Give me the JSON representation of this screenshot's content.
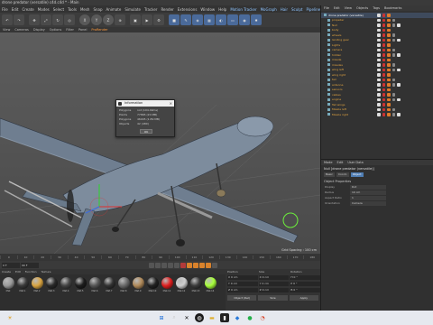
{
  "window": {
    "title": "drone predator (versatile) c4d.c4d * - Main"
  },
  "menubar": {
    "items": [
      "File",
      "Edit",
      "Create",
      "Modes",
      "Select",
      "Tools",
      "Mesh",
      "Snap",
      "Animate",
      "Simulate",
      "Tracker",
      "Render",
      "Extensions",
      "Window",
      "Help"
    ],
    "highlighted": [
      "Motion Tracker",
      "MoGraph",
      "Hair",
      "Sculpt",
      "Pipeline",
      "Plugins",
      "Script",
      "Window",
      "Help"
    ]
  },
  "toolbar": {
    "axis_x": "X",
    "axis_y": "Y",
    "axis_z": "Z"
  },
  "viewport_menu": {
    "items": [
      "View",
      "Cameras",
      "Display",
      "Options",
      "Filter",
      "Panel"
    ],
    "active": "ProRender"
  },
  "viewport": {
    "grid_spacing": "Grid Spacing : 100 cm"
  },
  "info_dialog": {
    "title": "Information",
    "rows": [
      {
        "label": "Polygons",
        "value": "not (104.49ms)"
      },
      {
        "label": "Points",
        "value": "77865 (20 MB)"
      },
      {
        "label": "Polygons",
        "value": "46045 (1.89 MB)"
      },
      {
        "label": "Objects",
        "value": "42 (480)"
      }
    ],
    "ok_label": "OK"
  },
  "timeline": {
    "ticks": [
      "0",
      "10",
      "20",
      "30",
      "40",
      "50",
      "60",
      "70",
      "80",
      "90",
      "100",
      "110",
      "120",
      "130",
      "140",
      "150",
      "160",
      "170",
      "180"
    ]
  },
  "transport": {
    "start_frame": "0 F",
    "end_frame": "90 F"
  },
  "materials": {
    "menu": [
      "Create",
      "Edit",
      "Function",
      "Texture"
    ],
    "items": [
      {
        "name": "Mat",
        "color": "#9a9a9a"
      },
      {
        "name": "Mat.1",
        "color": "#3a3a3a"
      },
      {
        "name": "Mat.2",
        "color": "#d9a441"
      },
      {
        "name": "Mat.3",
        "color": "#2a2a2a"
      },
      {
        "name": "Mat.4",
        "color": "#444444"
      },
      {
        "name": "Mat.5",
        "color": "#1e1e1e"
      },
      {
        "name": "Mat.6",
        "color": "#555555"
      },
      {
        "name": "Mat.7",
        "color": "#333333"
      },
      {
        "name": "Mat.8",
        "color": "#6a6a6a"
      },
      {
        "name": "Mat.9",
        "color": "#b08a5a"
      },
      {
        "name": "Mat.10",
        "color": "#222222"
      },
      {
        "name": "Mat.11",
        "color": "#e02020"
      },
      {
        "name": "Mat.12",
        "color": "#cfcfcf"
      },
      {
        "name": "Mat.13",
        "color": "#3c3c3c"
      },
      {
        "name": "Mat.14",
        "color": "#a8ff3a"
      }
    ]
  },
  "coordinates": {
    "headers": [
      "Position",
      "Size",
      "Rotation"
    ],
    "rows": [
      [
        "X 0 cm",
        "X 0 cm",
        "H 0 °"
      ],
      [
        "Y 0 cm",
        "Y 0 cm",
        "P 0 °"
      ],
      [
        "Z 0 cm",
        "Z 0 cm",
        "B 0 °"
      ]
    ],
    "object_mode": "Object (Rel)",
    "size_mode": "Size",
    "apply_label": "Apply"
  },
  "object_manager": {
    "menu": [
      "File",
      "Edit",
      "View",
      "Objects",
      "Tags",
      "Bookmarks"
    ],
    "objects": [
      "drone predator (versatile)",
      "propeller",
      "Null",
      "body",
      "wheels",
      "landing gear",
      "Lights",
      "camera",
      "hidden",
      "missile",
      "missiles",
      "wing left",
      "wing right",
      "tail",
      "antenna",
      "sensors",
      "cables",
      "engine",
      "Tail wings",
      "Missile left",
      "Missile right"
    ]
  },
  "attribute_manager": {
    "menu": [
      "Mode",
      "Edit",
      "User Data"
    ],
    "object_label": "Null [drone predator (versatile)]",
    "tabs": [
      "Basic",
      "Coord.",
      "Object"
    ],
    "active_tab": "Object",
    "section": "Object Properties",
    "props": [
      {
        "label": "Display",
        "value": "Dot"
      },
      {
        "label": "Radius",
        "value": "10 cm"
      },
      {
        "label": "Aspect Ratio",
        "value": "1"
      },
      {
        "label": "Orientation",
        "value": "Camera"
      }
    ]
  },
  "colors": {
    "accent": "#4f7db3",
    "object_text": "#e1a441",
    "drone_body": "#7d8c9d"
  }
}
